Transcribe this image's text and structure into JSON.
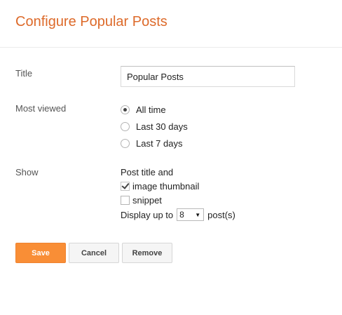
{
  "header": {
    "title": "Configure Popular Posts"
  },
  "title_field": {
    "label": "Title",
    "value": "Popular Posts"
  },
  "most_viewed": {
    "label": "Most viewed",
    "options": [
      {
        "label": "All time",
        "checked": true
      },
      {
        "label": "Last 30 days",
        "checked": false
      },
      {
        "label": "Last 7 days",
        "checked": false
      }
    ]
  },
  "show": {
    "label": "Show",
    "intro": "Post title and",
    "options": [
      {
        "label": "image thumbnail",
        "checked": true
      },
      {
        "label": "snippet",
        "checked": false
      }
    ],
    "display_prefix": "Display up to",
    "count_value": "8",
    "display_suffix": "post(s)"
  },
  "buttons": {
    "save": "Save",
    "cancel": "Cancel",
    "remove": "Remove"
  },
  "colors": {
    "title_accent": "#dd6a2a",
    "save_button": "#f98e36"
  }
}
